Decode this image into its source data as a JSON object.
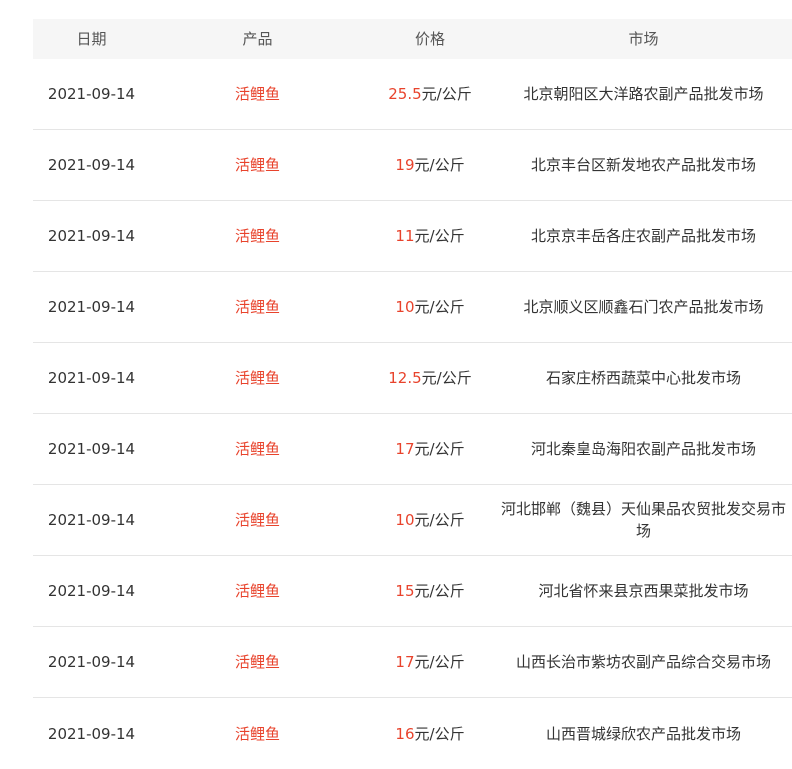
{
  "table": {
    "headers": {
      "date": "日期",
      "product": "产品",
      "price": "价格",
      "market": "市场"
    },
    "rows": [
      {
        "date": "2021-09-14",
        "product": "活鲤鱼",
        "price_value": "25.5",
        "price_unit": "元/公斤",
        "market": "北京朝阳区大洋路农副产品批发市场"
      },
      {
        "date": "2021-09-14",
        "product": "活鲤鱼",
        "price_value": "19",
        "price_unit": "元/公斤",
        "market": "北京丰台区新发地农产品批发市场"
      },
      {
        "date": "2021-09-14",
        "product": "活鲤鱼",
        "price_value": "11",
        "price_unit": "元/公斤",
        "market": "北京京丰岳各庄农副产品批发市场"
      },
      {
        "date": "2021-09-14",
        "product": "活鲤鱼",
        "price_value": "10",
        "price_unit": "元/公斤",
        "market": "北京顺义区顺鑫石门农产品批发市场"
      },
      {
        "date": "2021-09-14",
        "product": "活鲤鱼",
        "price_value": "12.5",
        "price_unit": "元/公斤",
        "market": "石家庄桥西蔬菜中心批发市场"
      },
      {
        "date": "2021-09-14",
        "product": "活鲤鱼",
        "price_value": "17",
        "price_unit": "元/公斤",
        "market": "河北秦皇岛海阳农副产品批发市场"
      },
      {
        "date": "2021-09-14",
        "product": "活鲤鱼",
        "price_value": "10",
        "price_unit": "元/公斤",
        "market": "河北邯郸（魏县）天仙果品农贸批发交易市场"
      },
      {
        "date": "2021-09-14",
        "product": "活鲤鱼",
        "price_value": "15",
        "price_unit": "元/公斤",
        "market": "河北省怀来县京西果菜批发市场"
      },
      {
        "date": "2021-09-14",
        "product": "活鲤鱼",
        "price_value": "17",
        "price_unit": "元/公斤",
        "market": "山西长治市紫坊农副产品综合交易市场"
      },
      {
        "date": "2021-09-14",
        "product": "活鲤鱼",
        "price_value": "16",
        "price_unit": "元/公斤",
        "market": "山西晋城绿欣农产品批发市场"
      }
    ]
  }
}
